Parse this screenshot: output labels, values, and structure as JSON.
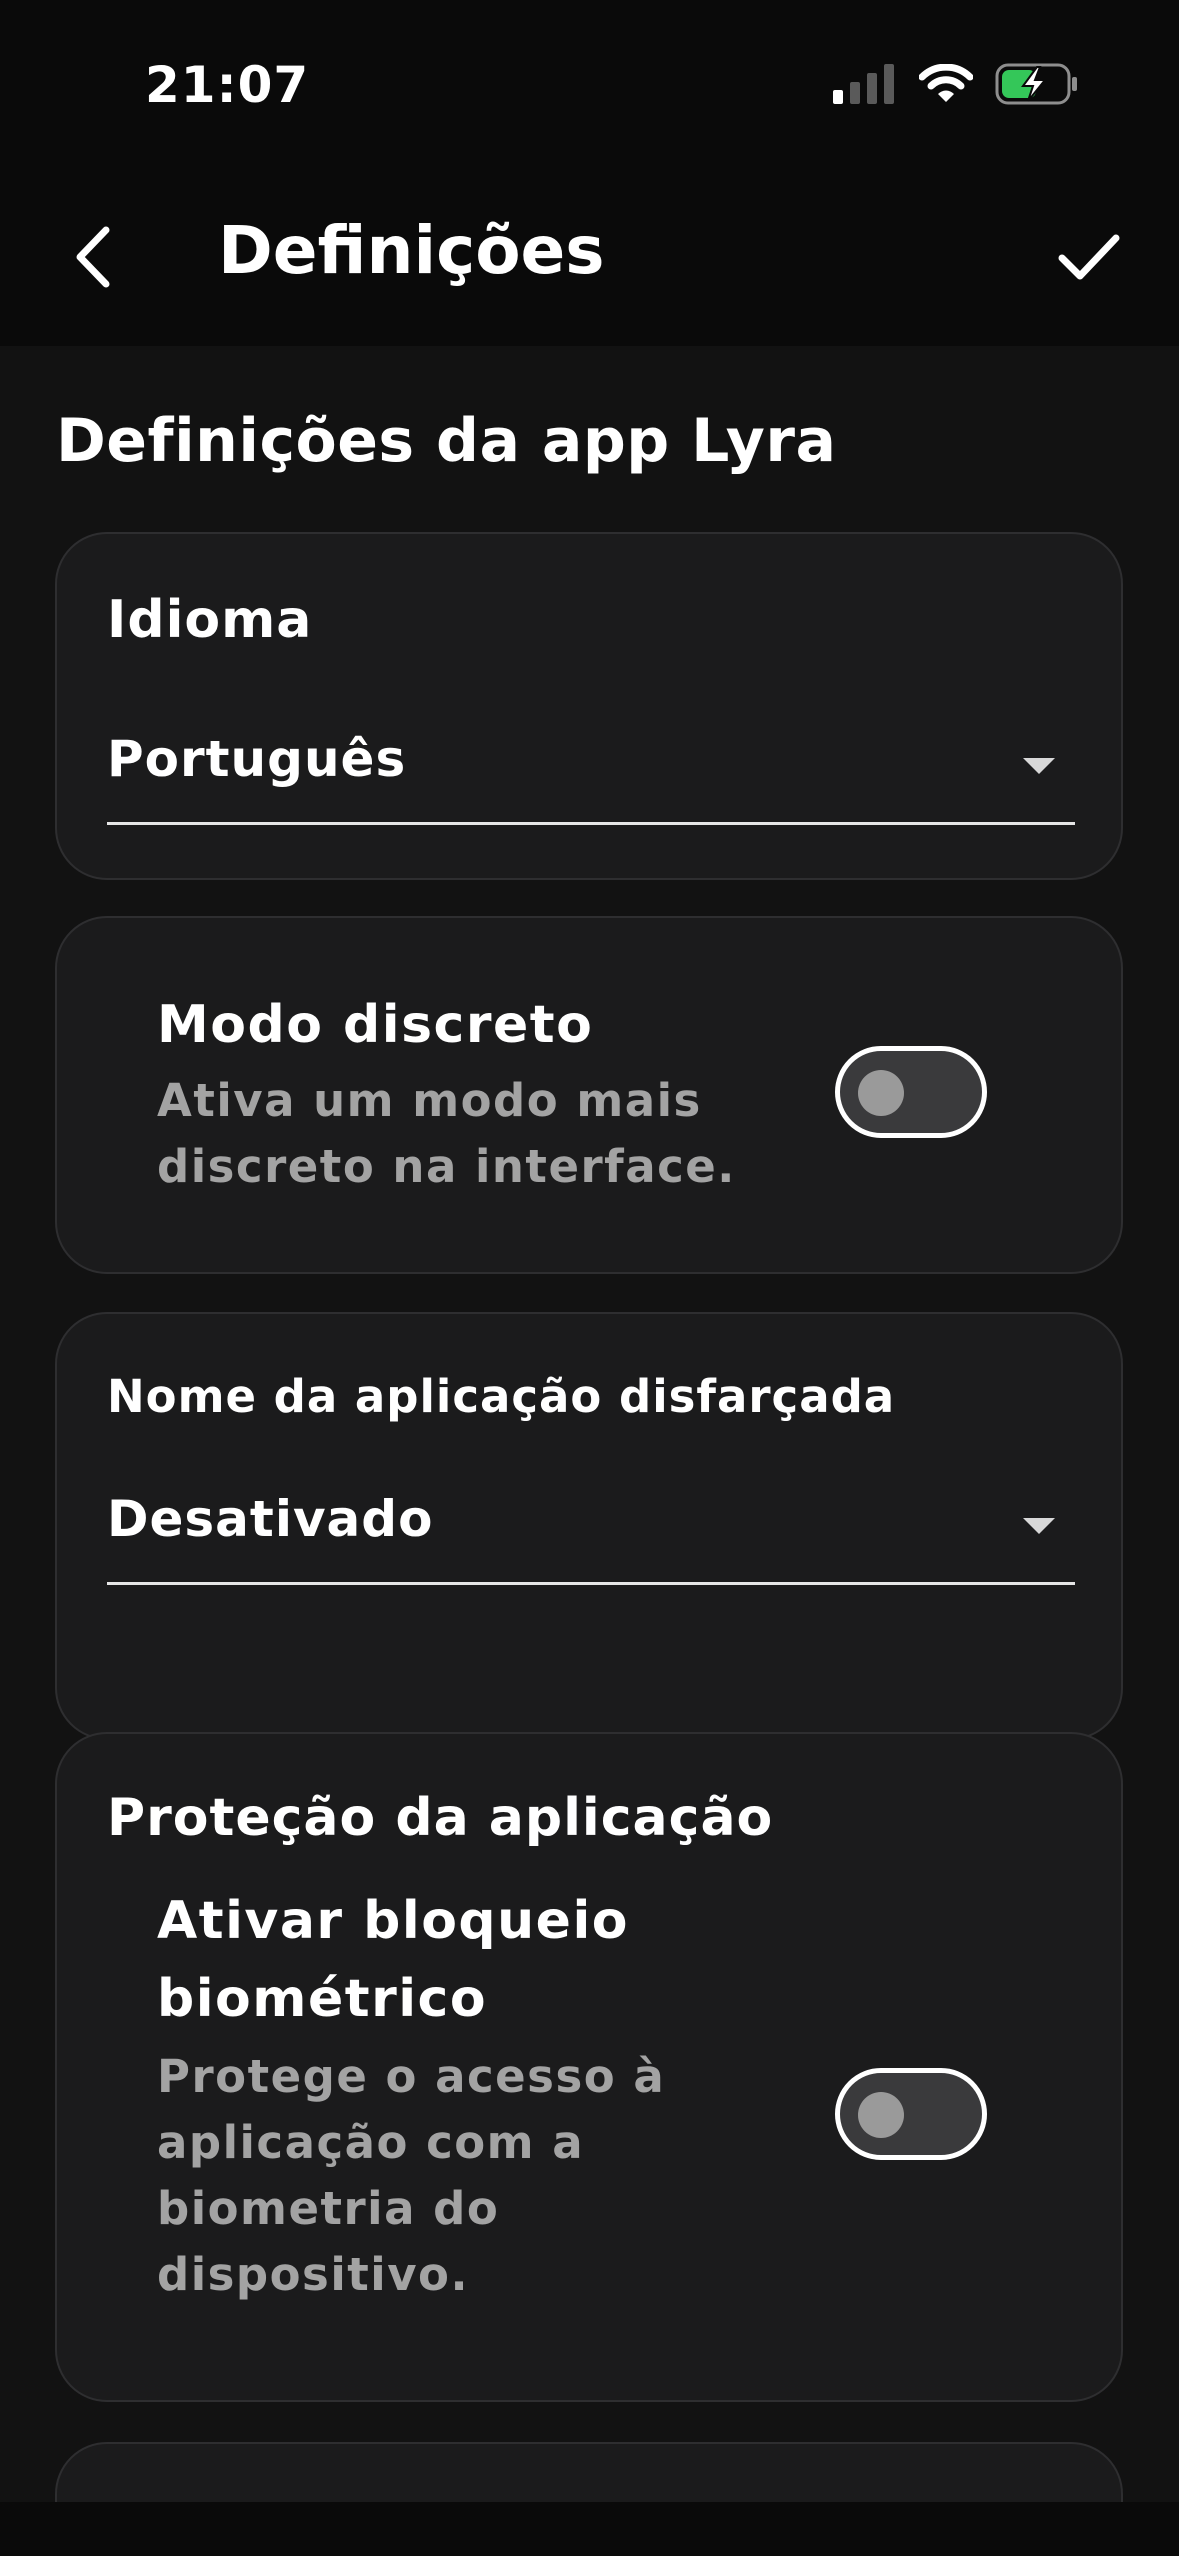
{
  "status_bar": {
    "time": "21:07",
    "icons": [
      "cellular-signal-icon",
      "wifi-icon",
      "battery-charging-icon"
    ],
    "battery_color": "#34c759"
  },
  "nav": {
    "title": "Definições",
    "back_icon": "chevron-left-icon",
    "confirm_icon": "checkmark-icon"
  },
  "section": {
    "title": "Definições da app Lyra"
  },
  "language": {
    "label": "Idioma",
    "value": "Português"
  },
  "discreet_mode": {
    "title": "Modo discreto",
    "description_line1": "Ativa um modo mais",
    "description_line2": "discreto na interface.",
    "enabled": false
  },
  "disguised_name": {
    "label": "Nome da aplicação disfarçada",
    "value": "Desativado"
  },
  "app_protection": {
    "label": "Proteção da aplicação",
    "biometric_title_line1": "Ativar bloqueio",
    "biometric_title_line2": "biométrico",
    "biometric_desc_line1": "Protege o acesso à",
    "biometric_desc_line2": "aplicação com a",
    "biometric_desc_line3": "biometria do",
    "biometric_desc_line4": "dispositivo.",
    "biometric_enabled": false
  },
  "colors": {
    "background": "#0a0a0a",
    "content_background": "#121212",
    "card_background": "#1b1b1c",
    "muted_text": "#a3a3a3"
  }
}
